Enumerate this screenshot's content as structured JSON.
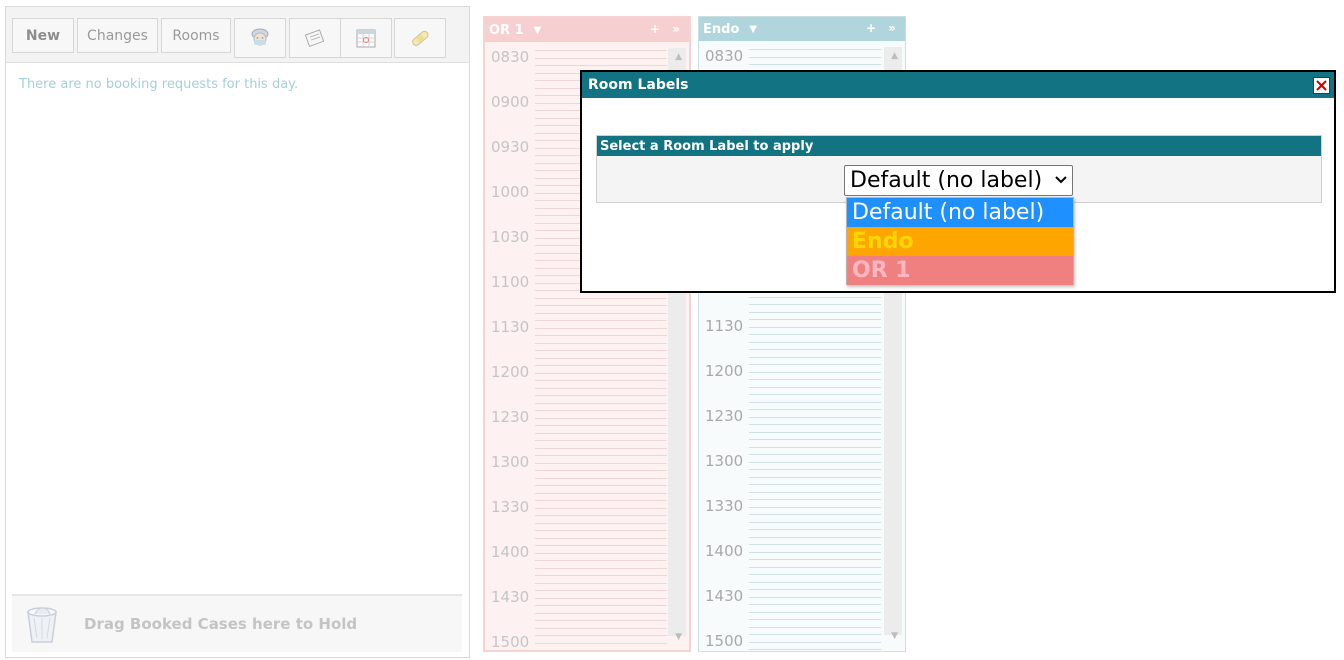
{
  "toolbar": {
    "new_label": "New",
    "changes_label": "Changes",
    "rooms_label": "Rooms",
    "icons": [
      "surgeon-icon",
      "notepad-icon",
      "calendar-icon",
      "bandage-icon"
    ]
  },
  "requests": {
    "empty_message": "There are no booking requests for this day."
  },
  "hold": {
    "label": "Drag Booked Cases here to Hold"
  },
  "rooms": [
    {
      "name": "OR 1",
      "actions": "+ »"
    },
    {
      "name": "Endo",
      "actions": "+ »"
    }
  ],
  "times": [
    "0830",
    "0900",
    "0930",
    "1000",
    "1030",
    "1100",
    "1130",
    "1200",
    "1230",
    "1300",
    "1330",
    "1400",
    "1430",
    "1500"
  ],
  "dialog": {
    "title": "Room Labels",
    "section_title": "Select a Room Label to apply",
    "selected": "Default (no label)",
    "options": [
      {
        "label": "Default (no label)",
        "bg": "#1e90ff",
        "fg": "#ffffff"
      },
      {
        "label": "Endo",
        "bg": "#ffa500",
        "fg": "#ffd700"
      },
      {
        "label": "OR 1",
        "bg": "#f08080",
        "fg": "#ffb6c1"
      }
    ]
  },
  "colors": {
    "dialog_header": "#127482",
    "or1_header": "#f6d0d0",
    "endo_header": "#b1d5dd",
    "empty_message": "#a6cfd8"
  }
}
